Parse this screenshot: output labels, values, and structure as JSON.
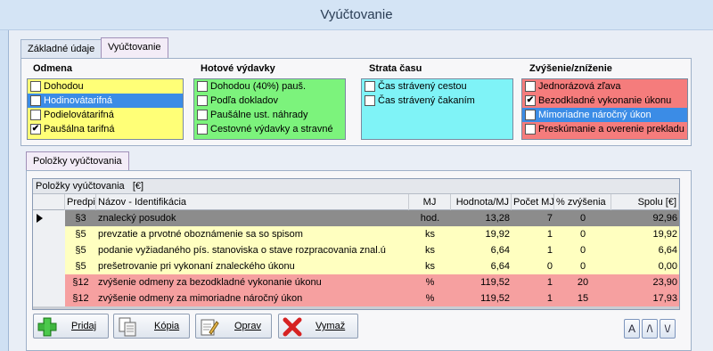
{
  "window": {
    "title": "Vyúčtovanie"
  },
  "tabs": [
    {
      "label": "Základné údaje",
      "active": false
    },
    {
      "label": "Vyúčtovanie",
      "active": true
    }
  ],
  "groups": {
    "odmena": {
      "title": "Odmena",
      "color": "#ffff77",
      "items": [
        {
          "label": "Dohodou",
          "checked": false,
          "selected": false
        },
        {
          "label": "Hodinovátarifná",
          "checked": true,
          "selected": true
        },
        {
          "label": "Podielovátarifná",
          "checked": false,
          "selected": false
        },
        {
          "label": "Paušálna tarifná",
          "checked": true,
          "selected": false
        }
      ]
    },
    "hotove": {
      "title": "Hotové výdavky",
      "color": "#7cf37c",
      "items": [
        {
          "label": "Dohodou (40%) pauš.",
          "checked": false
        },
        {
          "label": "Podľa dokladov",
          "checked": false
        },
        {
          "label": "Paušálne ust. náhrady",
          "checked": false
        },
        {
          "label": "Cestovné výdavky a stravné",
          "checked": false
        }
      ]
    },
    "strata": {
      "title": "Strata času",
      "color": "#7ff3f7",
      "items": [
        {
          "label": "Čas strávený cestou",
          "checked": false
        },
        {
          "label": "Čas strávený čakaním",
          "checked": false
        }
      ]
    },
    "zvysenie": {
      "title": "Zvýšenie/zníženie",
      "color": "#f57c7c",
      "items": [
        {
          "label": "Jednorázová zľava",
          "checked": false,
          "selected": false
        },
        {
          "label": "Bezodkladné vykonanie úkonu",
          "checked": true,
          "selected": false
        },
        {
          "label": "Mimoriadne náročný úkon",
          "checked": true,
          "selected": true
        },
        {
          "label": "Preskúmanie a overenie prekladu",
          "checked": false,
          "selected": false
        }
      ]
    }
  },
  "polozky_tab": {
    "label": "Položky vyúčtovania"
  },
  "grid": {
    "caption": "Položky vyúčtovania",
    "caption_unit": "[€]",
    "columns": [
      "Predpis",
      "Názov - Identifikácia",
      "MJ",
      "Hodnota/MJ",
      "Počet MJ",
      "% zvýšenia",
      "Spolu [€]"
    ],
    "rows": [
      {
        "predpis": "§3",
        "nazov": "znalecký posudok",
        "mj": "hod.",
        "hodnota": "13,28",
        "pocet": "7",
        "zvysenie": "0",
        "spolu": "92,96",
        "style": "current"
      },
      {
        "predpis": "§5",
        "nazov": "prevzatie a prvotné oboznámenie sa so spisom",
        "mj": "ks",
        "hodnota": "19,92",
        "pocet": "1",
        "zvysenie": "0",
        "spolu": "19,92",
        "style": "yellow"
      },
      {
        "predpis": "§5",
        "nazov": "podanie vyžiadaného pís. stanoviska o stave rozpracovania znal.ú",
        "mj": "ks",
        "hodnota": "6,64",
        "pocet": "1",
        "zvysenie": "0",
        "spolu": "6,64",
        "style": "yellow"
      },
      {
        "predpis": "§5",
        "nazov": "prešetrovanie pri vykonaní znaleckého úkonu",
        "mj": "ks",
        "hodnota": "6,64",
        "pocet": "0",
        "zvysenie": "0",
        "spolu": "0,00",
        "style": "yellow"
      },
      {
        "predpis": "§12",
        "nazov": "zvýšenie odmeny za bezodkladné vykonanie úkonu",
        "mj": "%",
        "hodnota": "119,52",
        "pocet": "1",
        "zvysenie": "20",
        "spolu": "23,90",
        "style": "red"
      },
      {
        "predpis": "§12",
        "nazov": "zvýšenie odmeny za mimoriadne náročný úkon",
        "mj": "%",
        "hodnota": "119,52",
        "pocet": "1",
        "zvysenie": "15",
        "spolu": "17,93",
        "style": "red"
      }
    ]
  },
  "buttons": {
    "add": {
      "label": "Pridaj",
      "icon": "plus-icon"
    },
    "copy": {
      "label": "Kópia",
      "icon": "copy-icon"
    },
    "edit": {
      "label": "Oprav",
      "icon": "edit-icon"
    },
    "delete": {
      "label": "Vymaž",
      "icon": "delete-icon"
    },
    "sort_a": {
      "label": "A"
    },
    "up": {
      "label": "/\\"
    },
    "down": {
      "label": "\\/"
    }
  },
  "colors": {
    "row_current": "#8c8c8c",
    "row_yellow": "#ffffc0",
    "row_red": "#f6a0a0",
    "selection": "#3b8ce6"
  }
}
